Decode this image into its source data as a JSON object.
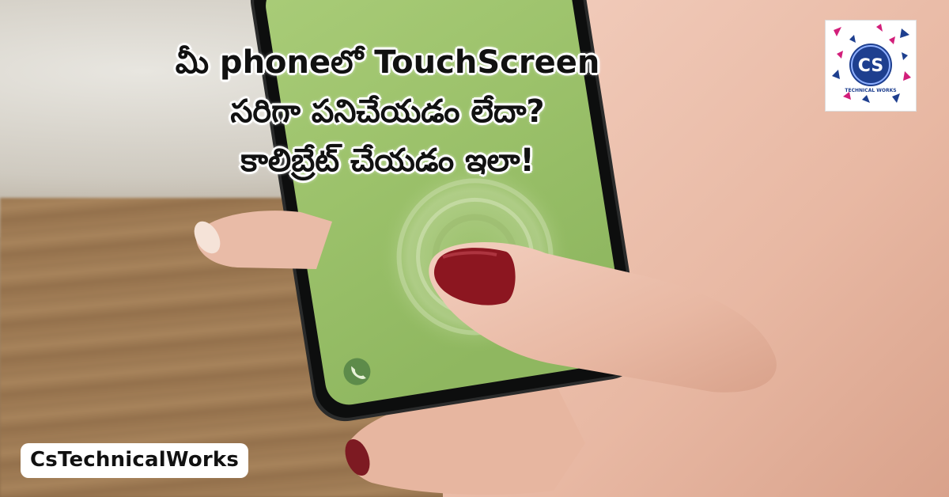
{
  "headline": {
    "line1": "మీ phoneలో TouchScreen",
    "line2": "సరిగా పనిచేయడం లేదా?",
    "line3": "కాలిబ్రేట్  చేయడం ఇలా!"
  },
  "logo": {
    "initials": "CS",
    "subtext": "TECHNICAL WORKS"
  },
  "watermark": "CsTechnicalWorks",
  "phone": {
    "icon": "phone-call-icon"
  },
  "colors": {
    "screen": "#9fc46c",
    "nail": "#8c1620",
    "logo_blue": "#1e3f8f",
    "logo_pink": "#d21e7a"
  }
}
